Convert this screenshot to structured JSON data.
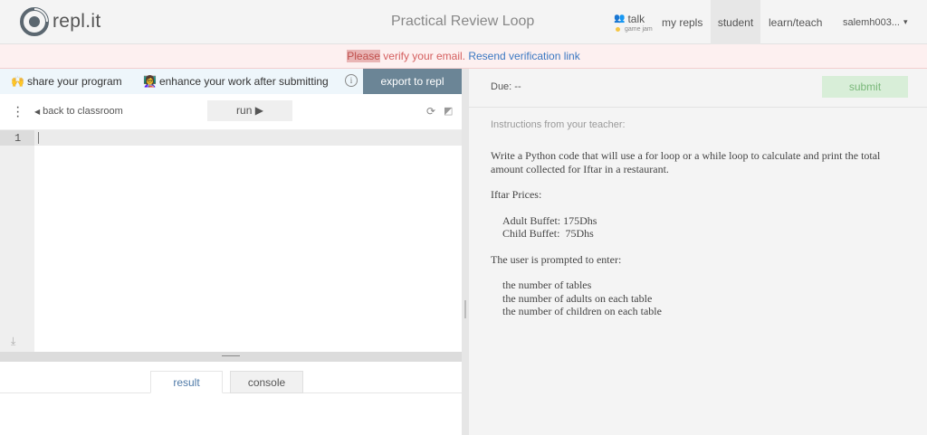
{
  "topbar": {
    "logo_text": "repl.it",
    "page_title": "Practical Review Loop",
    "nav": {
      "talk": "talk",
      "talk_sub": "game jam",
      "my_repls": "my repls",
      "student": "student",
      "learn_teach": "learn/teach",
      "user": "salemh003...",
      "user_caret": "▾"
    }
  },
  "banner": {
    "please": "Please",
    "text": " verify your email. ",
    "link": "Resend verification link"
  },
  "left": {
    "tips": {
      "share": "share your program",
      "share_emoji": "🙌",
      "enhance": "enhance your work after submitting",
      "enhance_emoji": "👩‍🏫",
      "info": "i"
    },
    "export_label": "export to repl",
    "back_label": "back to classroom",
    "run_label": "run ▶",
    "editor": {
      "line_numbers": [
        "1"
      ]
    },
    "tabs": {
      "result": "result",
      "console": "console"
    }
  },
  "right": {
    "due": "Due: --",
    "submit_label": "submit",
    "instructions_label": "Instructions from your teacher:",
    "instructions": {
      "task": "Write a Python code that will use a for loop or a while loop to calculate and print the total amount collected for Iftar in a restaurant.",
      "prices_title": "Iftar Prices:",
      "prices": [
        "Adult Buffet: 175Dhs",
        "Child Buffet:  75Dhs"
      ],
      "prompt_title": "The user is prompted to enter:",
      "prompts": [
        "the number of tables",
        "the number of adults on each table",
        "the number of children on each table"
      ]
    }
  },
  "colors": {
    "export_bg": "#6b8596",
    "submit_bg": "#d8eed8",
    "banner_bg": "#fdf0f0",
    "link": "#3b78c2"
  }
}
